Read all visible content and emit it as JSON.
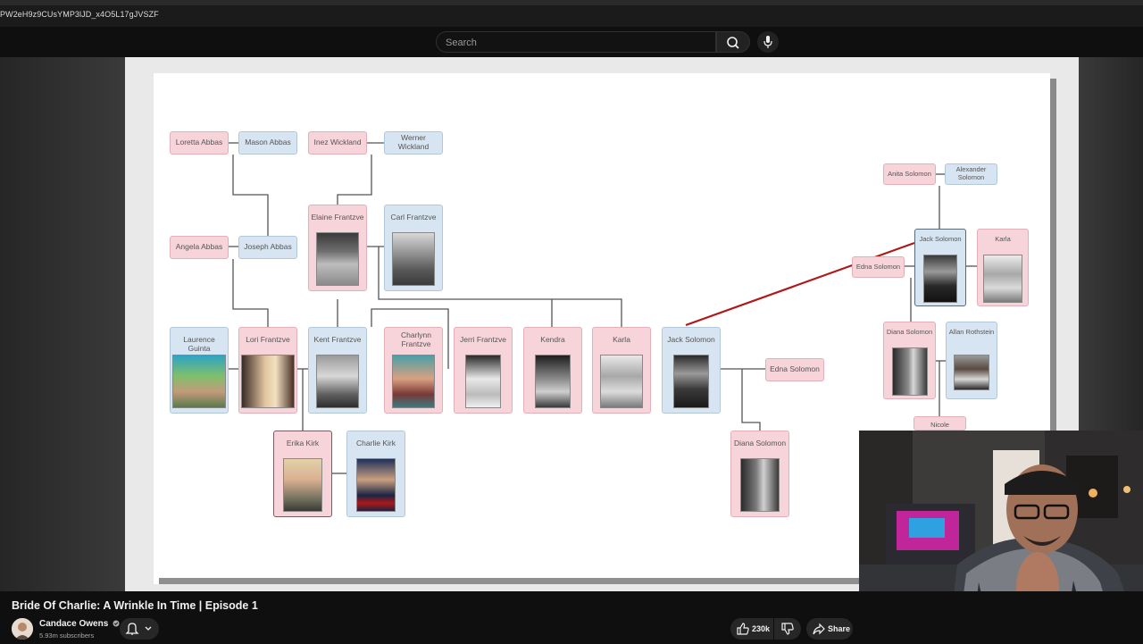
{
  "browser": {
    "url_fragment": "PW2eH9z9CUsYMP3lJD_x4O5L17gJVSZF"
  },
  "search": {
    "placeholder": "Search"
  },
  "tree": {
    "people": {
      "loretta_abbas": "Loretta Abbas",
      "mason_abbas": "Mason Abbas",
      "inez_wickland": "Inez Wickland",
      "werner_wickland": "Werner Wickland",
      "angela_abbas": "Angela Abbas",
      "joseph_abbas": "Joseph Abbas",
      "elaine_frantzve": "Elaine Frantzve",
      "carl_frantzve": "Carl Frantzve",
      "laurence_guinta": "Laurence Guinta",
      "lori_frantzve": "Lori Frantzve",
      "kent_frantzve": "Kent Frantzve",
      "charlynn_frantzve": "Charlynn Frantzve",
      "jerri_frantzve": "Jerri Frantzve",
      "kendra": "Kendra",
      "karla": "Karla",
      "jack_solomon": "Jack Solomon",
      "edna_solomon": "Edna Solomon",
      "diana_solomon": "Diana Solomon",
      "erika_kirk": "Erika Kirk",
      "charlie_kirk": "Charlie Kirk",
      "anita_solomon": "Anita Solomon",
      "alexander_solomon": "Alexander Solomon",
      "jack_solomon_2": "Jack Solomon",
      "karla_2": "Karla",
      "edna_solomon_2": "Edna Solomon",
      "diana_solomon_2": "Diana Solomon",
      "allan_rothstein": "Allan Rothstein",
      "nicole_rothstein": "Nicole Rothstein"
    },
    "connector_color": "#b01818"
  },
  "video": {
    "title": "Bride Of Charlie: A Wrinkle In Time | Episode 1",
    "channel": "Candace Owens",
    "subscribers": "5.93m subscribers",
    "likes": "230k",
    "share_label": "Share"
  },
  "icons": [
    "search-icon",
    "mic-icon",
    "verified-icon",
    "bell-icon",
    "chevron-down-icon",
    "thumbs-up-icon",
    "thumbs-down-icon",
    "share-icon"
  ]
}
